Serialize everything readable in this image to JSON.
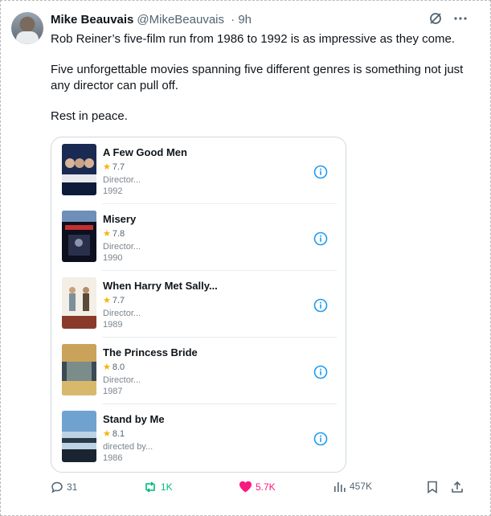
{
  "tweet": {
    "author_name": "Mike Beauvais",
    "handle": "@MikeBeauvais",
    "time": "· 9h",
    "paragraphs": [
      "Rob Reiner’s five-film run from 1986 to 1992 is as impressive as they come.",
      "Five unforgettable movies spanning five different genres is something not just any director can pull off.",
      "Rest in peace."
    ]
  },
  "movies": [
    {
      "title": "A Few Good Men",
      "rating": "7.7",
      "role": "Director...",
      "year": "1992",
      "poster": "a-few-good-men-poster"
    },
    {
      "title": "Misery",
      "rating": "7.8",
      "role": "Director...",
      "year": "1990",
      "poster": "misery-poster"
    },
    {
      "title": "When Harry Met Sally...",
      "rating": "7.7",
      "role": "Director...",
      "year": "1989",
      "poster": "when-harry-met-sally-poster"
    },
    {
      "title": "The Princess Bride",
      "rating": "8.0",
      "role": "Director...",
      "year": "1987",
      "poster": "the-princess-bride-poster"
    },
    {
      "title": "Stand by Me",
      "rating": "8.1",
      "role": "directed by...",
      "year": "1986",
      "poster": "stand-by-me-poster"
    }
  ],
  "actions": {
    "replies": "31",
    "reposts": "1K",
    "likes": "5.7K",
    "views": "457K"
  },
  "colors": {
    "repost_green": "#00ba7c",
    "like_pink": "#f91880",
    "info_blue": "#1d9bf0",
    "star_gold": "#f5b400"
  }
}
